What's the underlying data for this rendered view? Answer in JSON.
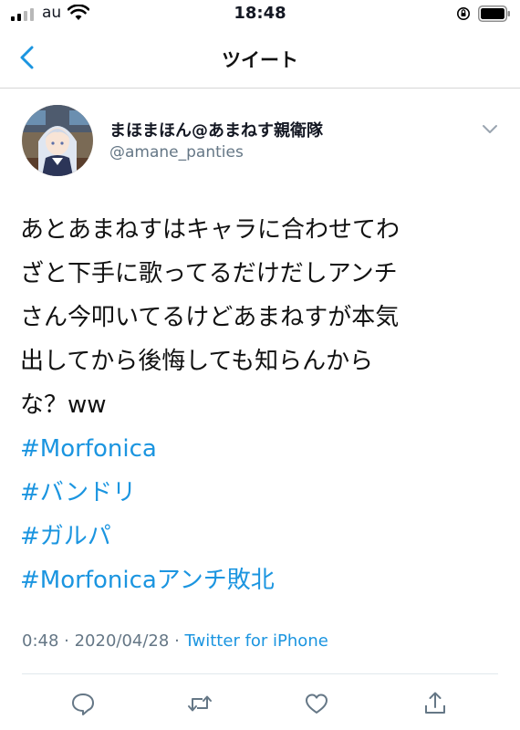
{
  "status_bar": {
    "carrier": "au",
    "time": "18:48"
  },
  "nav": {
    "title": "ツイート",
    "back_icon": "chevron-left-icon"
  },
  "author": {
    "name": "まほまほん@あまねす親衛隊",
    "handle": "@amane_panties"
  },
  "tweet": {
    "lines": [
      "あとあまねすはキャラに合わせてわ",
      "ざと下手に歌ってるだけだしアンチ",
      "さん今叩いてるけどあまねすが本気",
      "出してから後悔しても知らんから",
      "な？ww"
    ],
    "hashtags": [
      "#Morfonica",
      "#バンドリ",
      "#ガルパ",
      "#Morfonicaアンチ敗北"
    ],
    "time": "0:48",
    "separator1": " · ",
    "date": "2020/04/28",
    "separator2": " · ",
    "source": "Twitter for iPhone"
  },
  "actions": {
    "icons": [
      "reply-icon",
      "retweet-icon",
      "like-icon",
      "share-icon"
    ]
  },
  "colors": {
    "accent": "#1b95e0",
    "secondary_text": "#657786",
    "text": "#141823",
    "divider": "#e1e8ed"
  }
}
